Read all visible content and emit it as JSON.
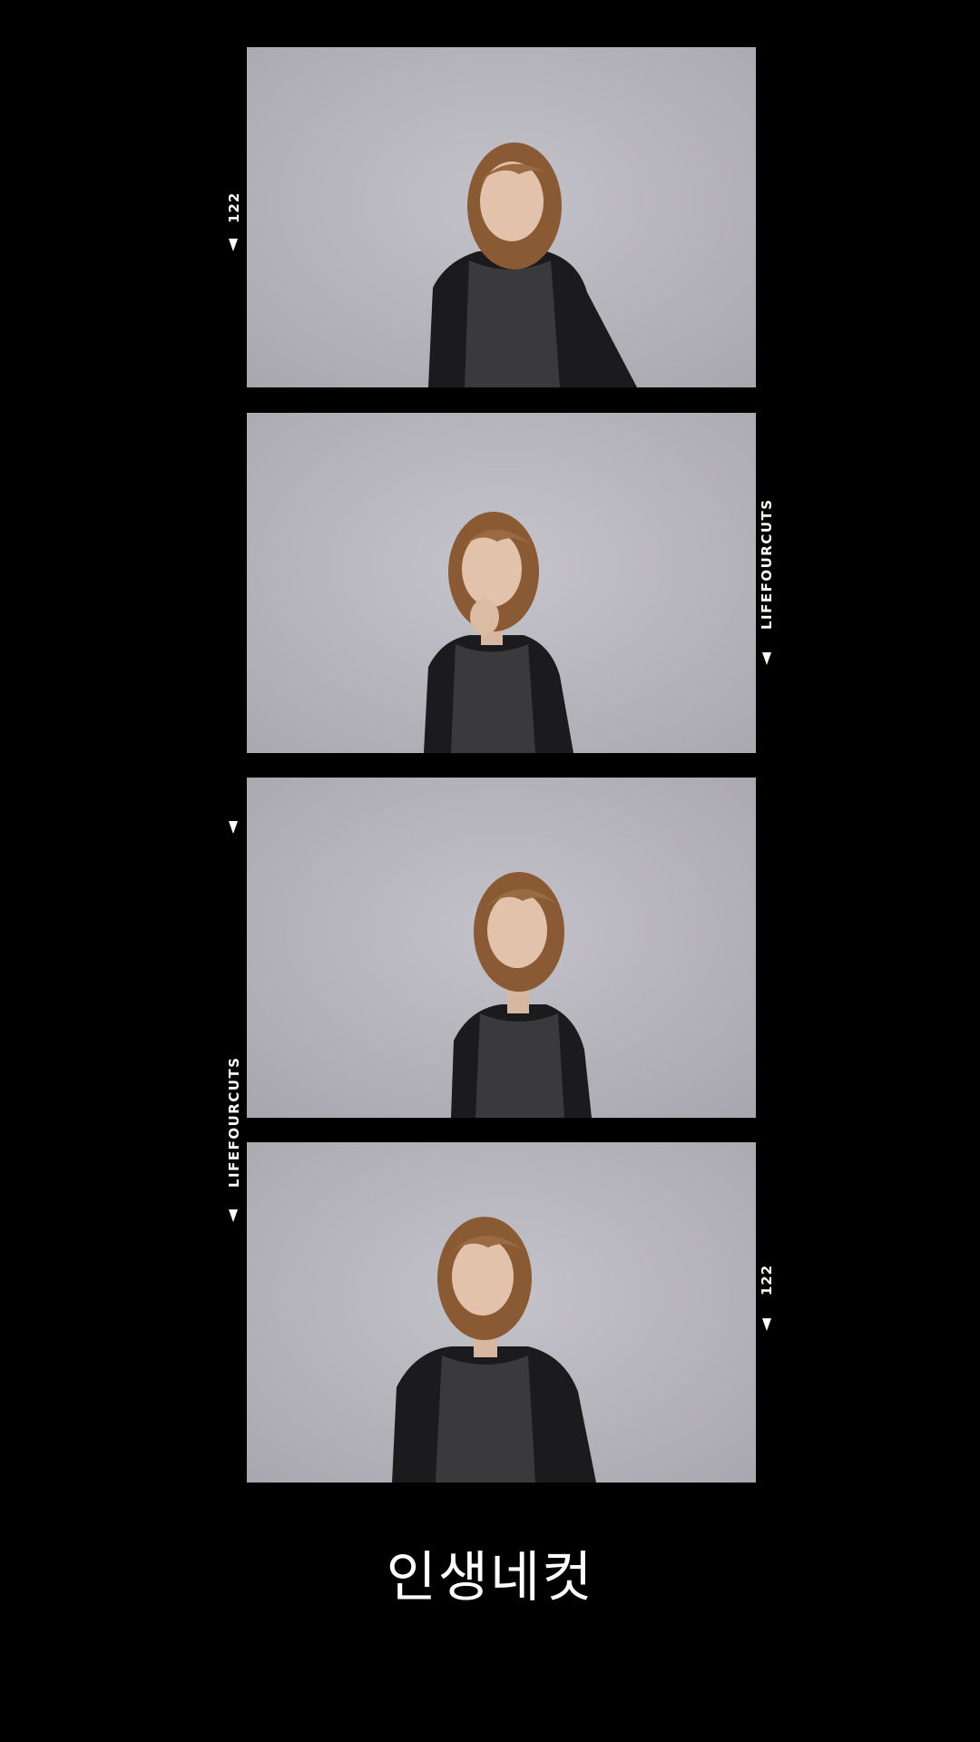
{
  "edge_marks": {
    "frame_number_top": "122",
    "brand_right": "LIFEFOURCUTS",
    "brand_left": "LIFEFOURCUTS",
    "frame_number_bottom": "122"
  },
  "caption": "인생네컷",
  "colors": {
    "film": "#000000",
    "backdrop": "#b9b7be",
    "marks": "#ffffff"
  },
  "photos": [
    {
      "pose": "head-tilt, jacket off shoulders"
    },
    {
      "pose": "hand at chin"
    },
    {
      "pose": "head-tilt, eyes closed"
    },
    {
      "pose": "smiling, hands at hips"
    }
  ]
}
